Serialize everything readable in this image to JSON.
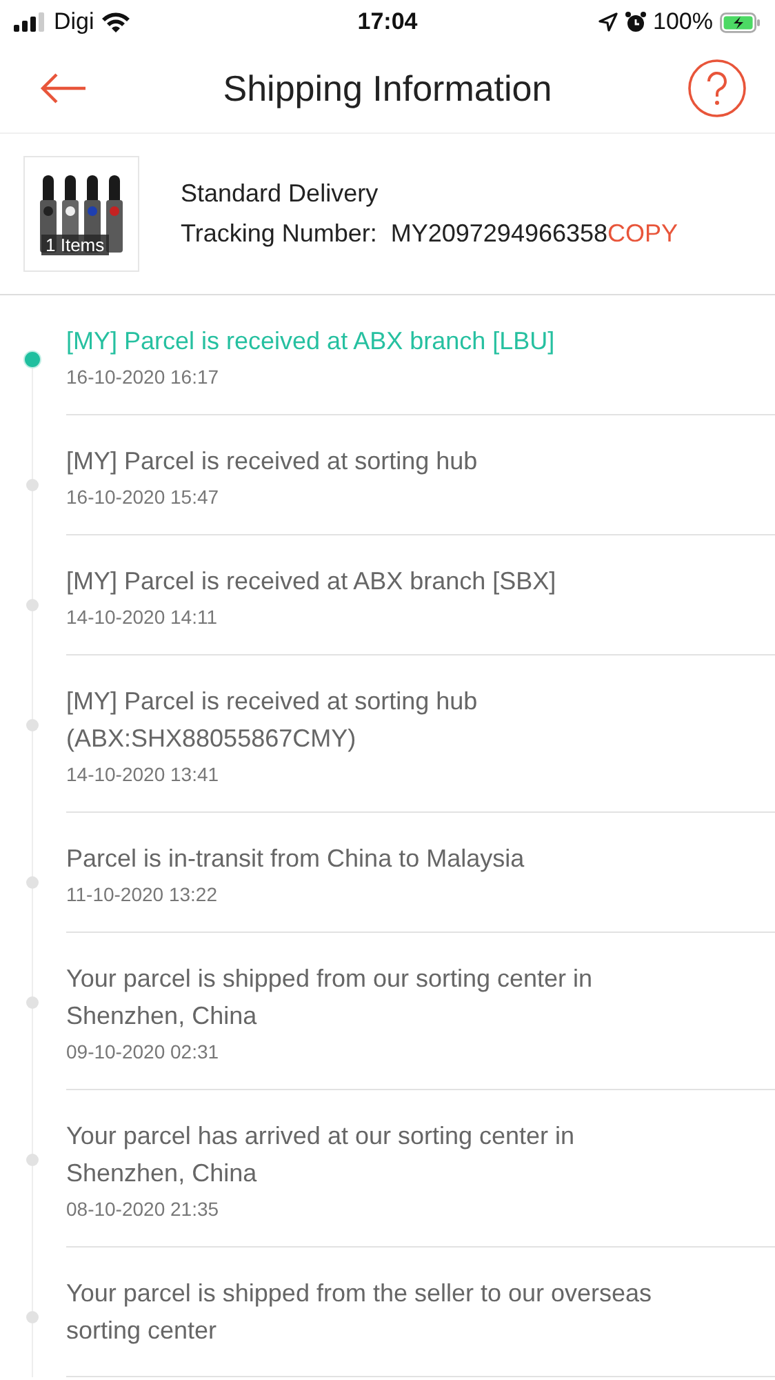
{
  "status_bar": {
    "carrier": "Digi",
    "time": "17:04",
    "battery": "100%"
  },
  "nav": {
    "title": "Shipping Information"
  },
  "shipment": {
    "item_count": "1 Items",
    "service": "Standard Delivery",
    "tracking_label": "Tracking Number:",
    "tracking_number": "MY2097294966358",
    "copy": "COPY"
  },
  "events": [
    {
      "text": "[MY] Parcel is received at ABX branch [LBU]",
      "time": "16-10-2020 16:17",
      "current": true
    },
    {
      "text": "[MY] Parcel is received at sorting hub",
      "time": "16-10-2020 15:47",
      "current": false
    },
    {
      "text": "[MY] Parcel is received at ABX branch [SBX]",
      "time": "14-10-2020 14:11",
      "current": false
    },
    {
      "text": "[MY] Parcel is received at sorting hub (ABX:SHX88055867CMY)",
      "time": "14-10-2020 13:41",
      "current": false
    },
    {
      "text": "Parcel is in-transit from China to Malaysia",
      "time": "11-10-2020 13:22",
      "current": false
    },
    {
      "text": "Your parcel is shipped from our sorting center in Shenzhen, China",
      "time": "09-10-2020 02:31",
      "current": false
    },
    {
      "text": "Your parcel has arrived at our sorting center in Shenzhen, China",
      "time": "08-10-2020 21:35",
      "current": false
    },
    {
      "text": "Your parcel is shipped from the seller to our overseas sorting center",
      "current": false
    }
  ]
}
